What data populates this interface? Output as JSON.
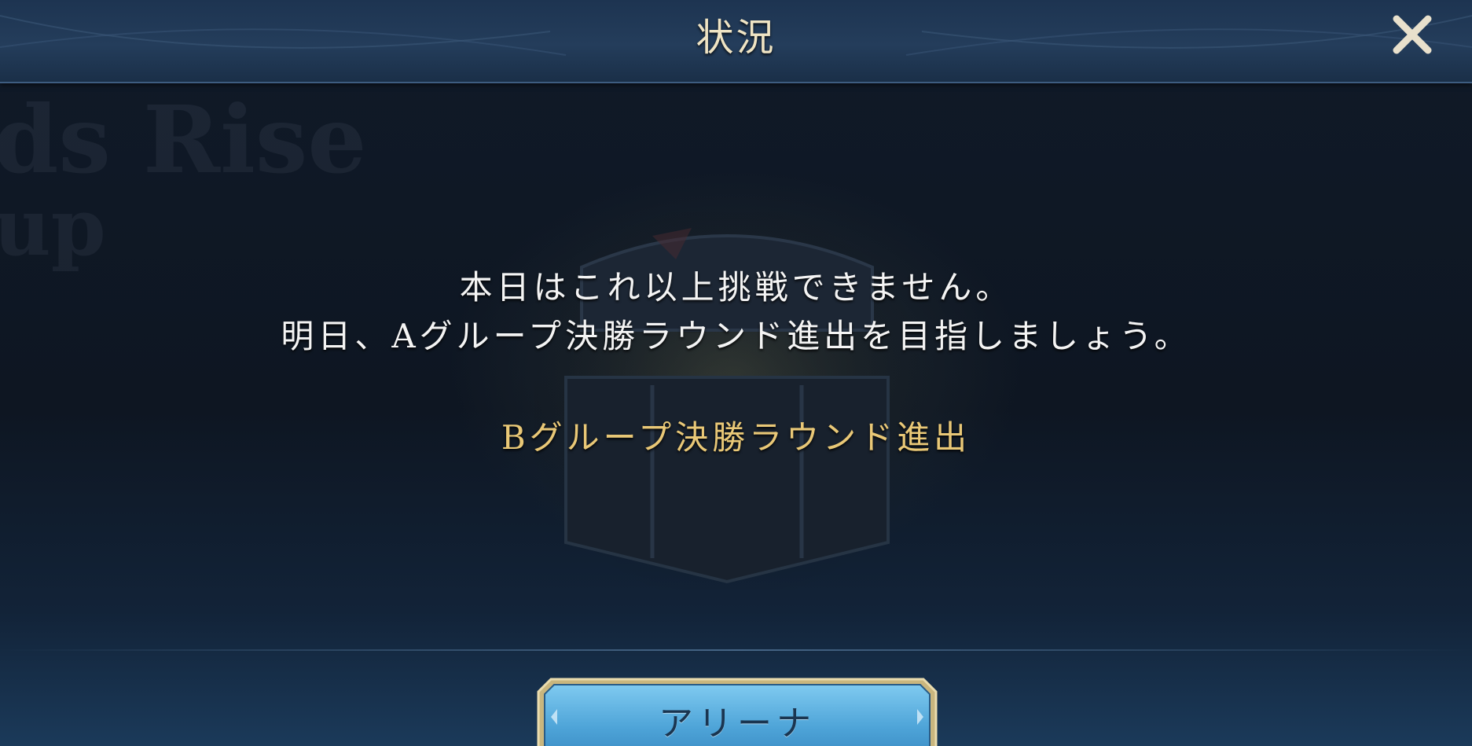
{
  "dialog": {
    "title": "状況",
    "message_line1": "本日はこれ以上挑戦できません。",
    "message_line2": "明日、Aグループ決勝ラウンド進出を目指しましょう。",
    "status": "Bグループ決勝ラウンド進出",
    "button_label": "アリーナ"
  },
  "icons": {
    "close": "close-icon"
  },
  "colors": {
    "title_text": "#efe4c4",
    "status_text": "#e9c877",
    "header_bg": "#243d5b",
    "button_blue": "#5fb6e6",
    "button_frame": "#d6c48c"
  }
}
